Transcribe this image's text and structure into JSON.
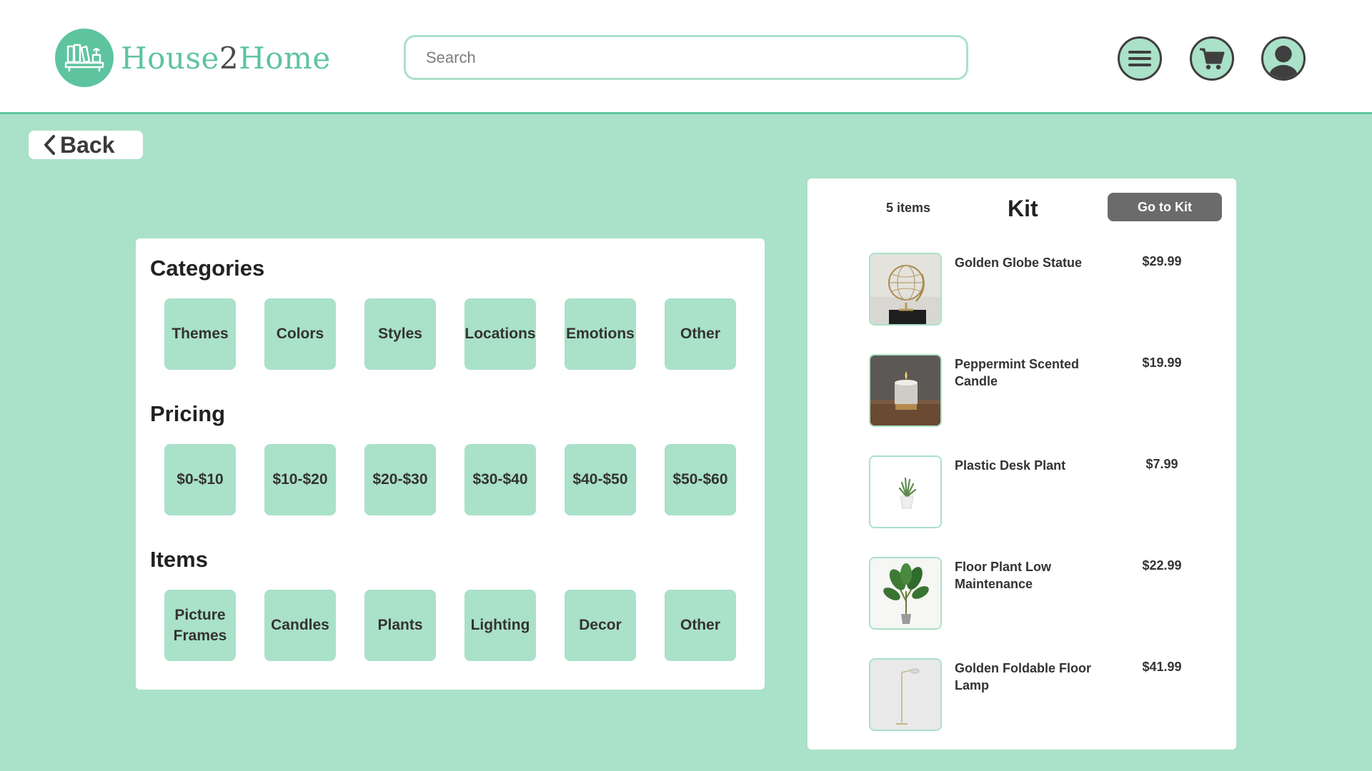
{
  "brand": {
    "name_part1": "House",
    "name_part2": "2",
    "name_part3": "Home",
    "accent": "#5ec49f",
    "light_accent": "#aae1c9"
  },
  "search": {
    "placeholder": "Search",
    "value": ""
  },
  "header_buttons": [
    {
      "icon": "menu-icon"
    },
    {
      "icon": "cart-icon"
    },
    {
      "icon": "account-icon"
    }
  ],
  "back": {
    "label": "Back"
  },
  "filters": {
    "categories": {
      "title": "Categories",
      "options": [
        "Themes",
        "Colors",
        "Styles",
        "Locations",
        "Emotions",
        "Other"
      ]
    },
    "pricing": {
      "title": "Pricing",
      "options": [
        "$0-$10",
        "$10-$20",
        "$20-$30",
        "$30-$40",
        "$40-$50",
        "$50-$60"
      ]
    },
    "items": {
      "title": "Items",
      "options": [
        "Picture Frames",
        "Candles",
        "Plants",
        "Lighting",
        "Decor",
        "Other"
      ]
    }
  },
  "kit": {
    "count_label": "5 items",
    "title": "Kit",
    "go_label": "Go to Kit",
    "items": [
      {
        "name": "Golden Globe Statue",
        "price": "$29.99",
        "image": "golden-globe-statue-image"
      },
      {
        "name": "Peppermint Scented Candle",
        "price": "$19.99",
        "image": "candle-image"
      },
      {
        "name": "Plastic Desk Plant",
        "price": "$7.99",
        "image": "desk-plant-image"
      },
      {
        "name": "Floor Plant Low Maintenance",
        "price": "$22.99",
        "image": "floor-plant-image"
      },
      {
        "name": "Golden Foldable Floor Lamp",
        "price": "$41.99",
        "image": "floor-lamp-image"
      }
    ]
  }
}
